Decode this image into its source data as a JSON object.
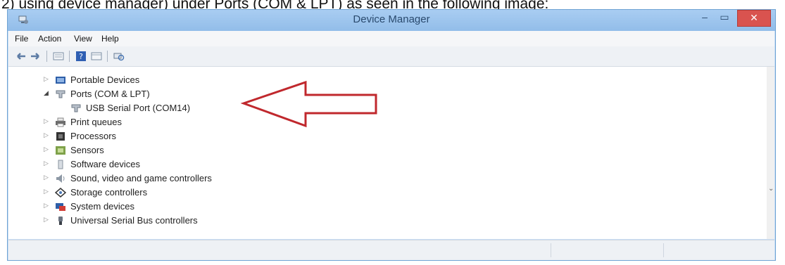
{
  "caption": "2) using device manager) under Ports (COM & LPT) as seen in the following image:",
  "window": {
    "title": "Device Manager",
    "minimize": "–",
    "maximize": "▭",
    "close": "✕"
  },
  "menu": [
    "File",
    "Action",
    "View",
    "Help"
  ],
  "toolbar_icons": [
    "back-arrow-icon",
    "forward-arrow-icon",
    "properties-icon",
    "help-icon",
    "view-icon",
    "scan-hardware-icon"
  ],
  "tree": [
    {
      "label": "Portable Devices",
      "expander": "▷",
      "icon": "portable-device-icon"
    },
    {
      "label": "Ports (COM & LPT)",
      "expander": "◢",
      "icon": "port-icon"
    },
    {
      "label": "USB Serial Port (COM14)",
      "expander": "",
      "icon": "port-icon",
      "child": true
    },
    {
      "label": "Print queues",
      "expander": "▷",
      "icon": "printer-icon"
    },
    {
      "label": "Processors",
      "expander": "▷",
      "icon": "processor-icon"
    },
    {
      "label": "Sensors",
      "expander": "▷",
      "icon": "sensor-icon"
    },
    {
      "label": "Software devices",
      "expander": "▷",
      "icon": "software-device-icon"
    },
    {
      "label": "Sound, video and game controllers",
      "expander": "▷",
      "icon": "speaker-icon"
    },
    {
      "label": "Storage controllers",
      "expander": "▷",
      "icon": "storage-icon"
    },
    {
      "label": "System devices",
      "expander": "▷",
      "icon": "system-device-icon"
    },
    {
      "label": "Universal Serial Bus controllers",
      "expander": "▷",
      "icon": "usb-icon"
    }
  ],
  "colors": {
    "titlebar": "#9dc5ee",
    "close_button": "#d9534f",
    "annotation_arrow": "#c0282d"
  }
}
